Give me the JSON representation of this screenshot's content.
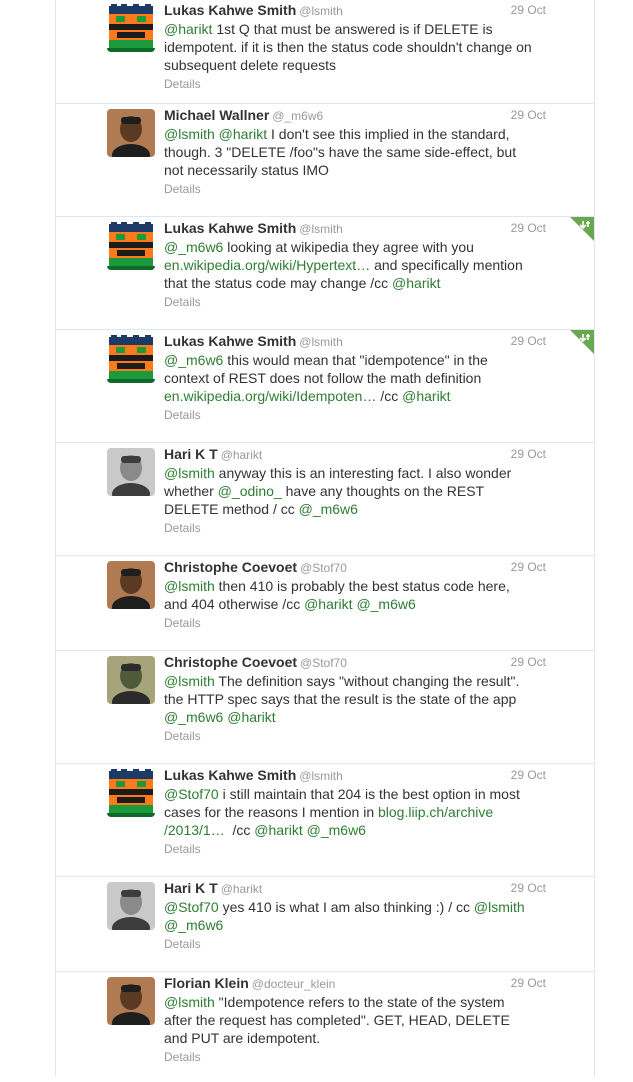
{
  "colors": {
    "link": "#2e7d32",
    "muted": "#999999",
    "text": "#333333",
    "border": "#e1e8ed",
    "retweet_corner": "#6aa84f"
  },
  "details_label": "Details",
  "tweets": [
    {
      "name": "Lukas Kahwe Smith",
      "handle": "@lsmith",
      "date": "29 Oct",
      "avatar": "lego-avatar-icon",
      "lines": [
        [
          {
            "t": "@harikt",
            "l": true
          },
          {
            "t": " 1st Q that must be answered is if DELETE is"
          }
        ],
        [
          {
            "t": "idempotent. if it is then the status code shouldn't change on"
          }
        ],
        [
          {
            "t": "subsequent delete requests"
          }
        ]
      ]
    },
    {
      "name": "Michael Wallner",
      "handle": "@_m6w6",
      "date": "29 Oct",
      "avatar": "user-photo-icon",
      "lines": [
        [
          {
            "t": "@lsmith",
            "l": true
          },
          {
            "t": " "
          },
          {
            "t": "@harikt",
            "l": true
          },
          {
            "t": " I don't see this implied in the standard,"
          }
        ],
        [
          {
            "t": "though. 3 \"DELETE /foo\"s have the same side-effect, but"
          }
        ],
        [
          {
            "t": "not necessarily status IMO"
          }
        ]
      ]
    },
    {
      "name": "Lukas Kahwe Smith",
      "handle": "@lsmith",
      "date": "29 Oct",
      "avatar": "lego-avatar-icon",
      "retweet": true,
      "lines": [
        [
          {
            "t": "@_m6w6",
            "l": true
          },
          {
            "t": " looking at wikipedia they agree with you"
          }
        ],
        [
          {
            "t": "en.wikipedia.org/wiki/Hypertext…",
            "l": true
          },
          {
            "t": " and specifically mention"
          }
        ],
        [
          {
            "t": "that the status code may change /cc "
          },
          {
            "t": "@harikt",
            "l": true
          }
        ]
      ]
    },
    {
      "name": "Lukas Kahwe Smith",
      "handle": "@lsmith",
      "date": "29 Oct",
      "avatar": "lego-avatar-icon",
      "retweet": true,
      "lines": [
        [
          {
            "t": "@_m6w6",
            "l": true
          },
          {
            "t": " this would mean that \"idempotence\" in the"
          }
        ],
        [
          {
            "t": "context of REST does not follow the math definition"
          }
        ],
        [
          {
            "t": "en.wikipedia.org/wiki/Idempoten…",
            "l": true
          },
          {
            "t": " /cc "
          },
          {
            "t": "@harikt",
            "l": true
          }
        ]
      ]
    },
    {
      "name": "Hari K T",
      "handle": "@harikt",
      "date": "29 Oct",
      "avatar": "user-photo-icon",
      "lines": [
        [
          {
            "t": "@lsmith",
            "l": true
          },
          {
            "t": " anyway this is an interesting fact. I also wonder"
          }
        ],
        [
          {
            "t": "whether "
          },
          {
            "t": "@_odino_",
            "l": true
          },
          {
            "t": " have any thoughts on the REST"
          }
        ],
        [
          {
            "t": "DELETE method / cc "
          },
          {
            "t": "@_m6w6",
            "l": true
          }
        ]
      ]
    },
    {
      "name": "Christophe Coevoet",
      "handle": "@Stof70",
      "date": "29 Oct",
      "avatar": "user-photo-icon",
      "lines": [
        [
          {
            "t": "@lsmith",
            "l": true
          },
          {
            "t": " then 410 is probably the best status code here,"
          }
        ],
        [
          {
            "t": "and 404 otherwise /cc "
          },
          {
            "t": "@harikt",
            "l": true
          },
          {
            "t": " "
          },
          {
            "t": "@_m6w6",
            "l": true
          }
        ]
      ]
    },
    {
      "name": "Christophe Coevoet",
      "handle": "@Stof70",
      "date": "29 Oct",
      "avatar": "user-photo-icon",
      "lines": [
        [
          {
            "t": "@lsmith",
            "l": true
          },
          {
            "t": " The definition says \"without changing the result\"."
          }
        ],
        [
          {
            "t": "the HTTP spec says that the result is the state of the app"
          }
        ],
        [
          {
            "t": "@_m6w6",
            "l": true
          },
          {
            "t": " "
          },
          {
            "t": "@harikt",
            "l": true
          }
        ]
      ]
    },
    {
      "name": "Lukas Kahwe Smith",
      "handle": "@lsmith",
      "date": "29 Oct",
      "avatar": "lego-avatar-icon",
      "lines": [
        [
          {
            "t": "@Stof70",
            "l": true
          },
          {
            "t": " i still maintain that 204 is the best option in most"
          }
        ],
        [
          {
            "t": "cases for the reasons I mention in "
          },
          {
            "t": "blog.liip.ch/archive",
            "l": true
          }
        ],
        [
          {
            "t": "/2013/1…",
            "l": true
          },
          {
            "t": "  /cc "
          },
          {
            "t": "@harikt",
            "l": true
          },
          {
            "t": " "
          },
          {
            "t": "@_m6w6",
            "l": true
          }
        ]
      ]
    },
    {
      "name": "Hari K T",
      "handle": "@harikt",
      "date": "29 Oct",
      "avatar": "user-photo-icon",
      "lines": [
        [
          {
            "t": "@Stof70",
            "l": true
          },
          {
            "t": " yes 410 is what I am also thinking :) / cc "
          },
          {
            "t": "@lsmith",
            "l": true
          }
        ],
        [
          {
            "t": "@_m6w6",
            "l": true
          }
        ]
      ]
    },
    {
      "name": "Florian Klein",
      "handle": "@docteur_klein",
      "date": "29 Oct",
      "avatar": "user-photo-icon",
      "lines": [
        [
          {
            "t": "@lsmith",
            "l": true
          },
          {
            "t": " \"Idempotence refers to the state of the system"
          }
        ],
        [
          {
            "t": "after the request has completed\". GET, HEAD, DELETE"
          }
        ],
        [
          {
            "t": "and PUT are idempotent."
          }
        ]
      ]
    }
  ]
}
